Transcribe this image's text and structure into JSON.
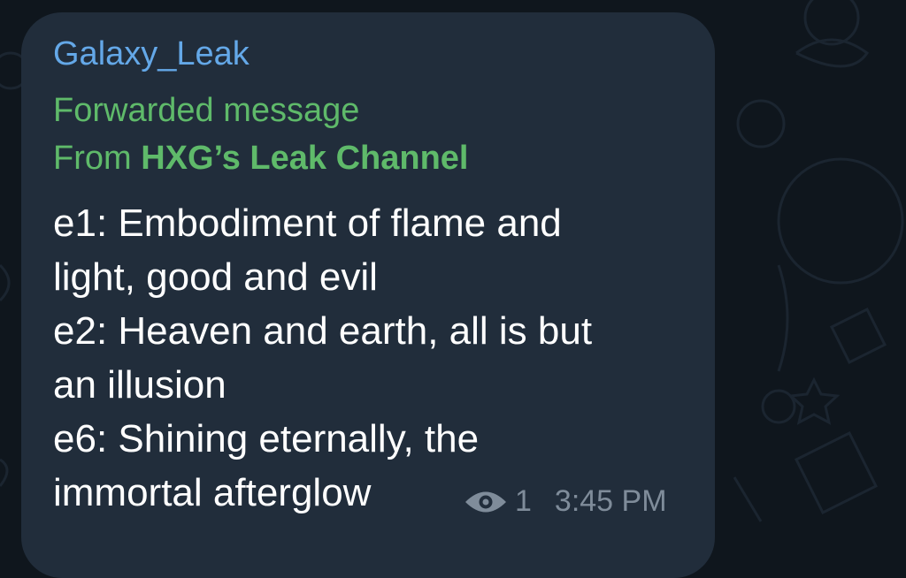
{
  "message": {
    "sender": "Galaxy_Leak",
    "forwarded_label": "Forwarded message",
    "forwarded_prefix": "From",
    "forwarded_channel": "HXG’s Leak Channel",
    "lines": [
      "e1: Embodiment of flame and",
      "light, good and evil",
      "e2: Heaven and earth, all is but",
      "an illusion",
      "e6: Shining eternally, the",
      "immortal afterglow"
    ],
    "views": "1",
    "time": "3:45 PM"
  },
  "icons": {
    "views": "eye-icon"
  },
  "colors": {
    "background": "#0f161d",
    "bubble": "#212d3b",
    "sender": "#64a8e8",
    "forwarded": "#5fba6a",
    "text": "#ffffff",
    "meta": "#7f8c9a"
  }
}
